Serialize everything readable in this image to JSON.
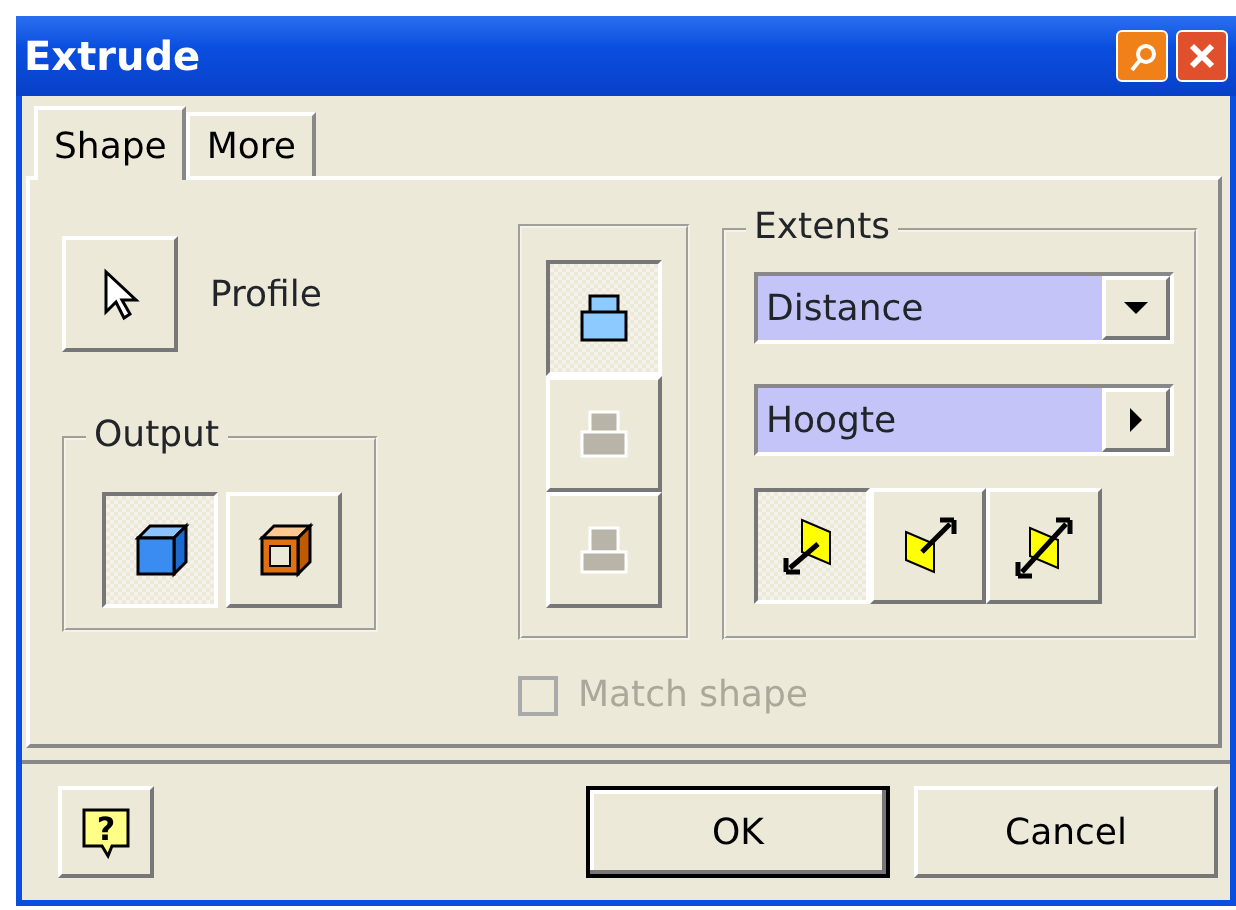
{
  "window": {
    "title": "Extrude"
  },
  "tabs": [
    {
      "label": "Shape",
      "selected": true
    },
    {
      "label": "More",
      "selected": false
    }
  ],
  "profile": {
    "label": "Profile"
  },
  "output": {
    "title": "Output",
    "options": [
      {
        "kind": "solid",
        "selected": true
      },
      {
        "kind": "surface",
        "selected": false
      }
    ]
  },
  "operations": [
    {
      "kind": "join",
      "selected": true,
      "disabled": false
    },
    {
      "kind": "cut",
      "selected": false,
      "disabled": true
    },
    {
      "kind": "intersect",
      "selected": false,
      "disabled": true
    }
  ],
  "extents": {
    "title": "Extents",
    "type": "Distance",
    "distance": "Hoogte",
    "directions": [
      {
        "kind": "one",
        "selected": true
      },
      {
        "kind": "two",
        "selected": false
      },
      {
        "kind": "symmetric",
        "selected": false
      }
    ]
  },
  "match_shape": {
    "label": "Match shape",
    "checked": false,
    "disabled": true
  },
  "help_button": {
    "symbol": "?"
  },
  "buttons": [
    {
      "label": "OK",
      "default": true
    },
    {
      "label": "Cancel",
      "default": false
    }
  ]
}
